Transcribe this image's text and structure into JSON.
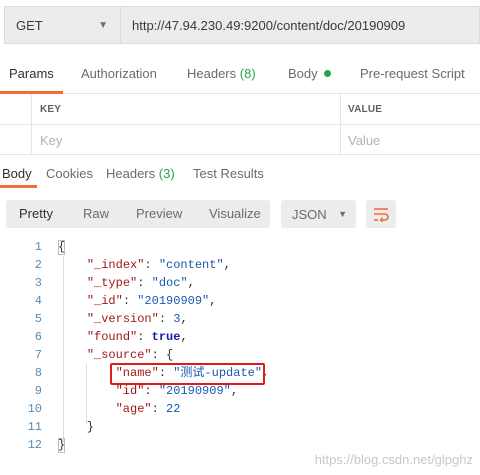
{
  "request": {
    "method": "GET",
    "url": "http://47.94.230.49:9200/content/doc/20190909"
  },
  "request_tabs": [
    {
      "label": "Params",
      "active": true
    },
    {
      "label": "Authorization"
    },
    {
      "label": "Headers",
      "count": "(8)"
    },
    {
      "label": "Body",
      "indicator": "green-dot"
    },
    {
      "label": "Pre-request Script"
    }
  ],
  "params_table": {
    "headers": [
      "KEY",
      "VALUE"
    ],
    "placeholders": [
      "Key",
      "Value"
    ]
  },
  "response_tabs": [
    {
      "label": "Body",
      "active": true
    },
    {
      "label": "Cookies"
    },
    {
      "label": "Headers",
      "count": "(3)"
    },
    {
      "label": "Test Results"
    }
  ],
  "view_modes": [
    "Pretty",
    "Raw",
    "Preview",
    "Visualize"
  ],
  "format": "JSON",
  "toolbar_icons": [
    "chevron-down-icon",
    "wrap-lines-icon"
  ],
  "code_lines": [
    [
      {
        "t": "p",
        "v": "{"
      }
    ],
    [
      {
        "t": "p",
        "v": "    "
      },
      {
        "t": "k",
        "v": "\"_index\""
      },
      {
        "t": "p",
        "v": ": "
      },
      {
        "t": "s",
        "v": "\"content\""
      },
      {
        "t": "p",
        "v": ","
      }
    ],
    [
      {
        "t": "p",
        "v": "    "
      },
      {
        "t": "k",
        "v": "\"_type\""
      },
      {
        "t": "p",
        "v": ": "
      },
      {
        "t": "s",
        "v": "\"doc\""
      },
      {
        "t": "p",
        "v": ","
      }
    ],
    [
      {
        "t": "p",
        "v": "    "
      },
      {
        "t": "k",
        "v": "\"_id\""
      },
      {
        "t": "p",
        "v": ": "
      },
      {
        "t": "s",
        "v": "\"20190909\""
      },
      {
        "t": "p",
        "v": ","
      }
    ],
    [
      {
        "t": "p",
        "v": "    "
      },
      {
        "t": "k",
        "v": "\"_version\""
      },
      {
        "t": "p",
        "v": ": "
      },
      {
        "t": "n",
        "v": "3"
      },
      {
        "t": "p",
        "v": ","
      }
    ],
    [
      {
        "t": "p",
        "v": "    "
      },
      {
        "t": "k",
        "v": "\"found\""
      },
      {
        "t": "p",
        "v": ": "
      },
      {
        "t": "b",
        "v": "true"
      },
      {
        "t": "p",
        "v": ","
      }
    ],
    [
      {
        "t": "p",
        "v": "    "
      },
      {
        "t": "k",
        "v": "\"_source\""
      },
      {
        "t": "p",
        "v": ": {"
      }
    ],
    [
      {
        "t": "p",
        "v": "        "
      },
      {
        "t": "k",
        "v": "\"name\""
      },
      {
        "t": "p",
        "v": ": "
      },
      {
        "t": "s",
        "v": "\"测试-update\""
      },
      {
        "t": "p",
        "v": ","
      }
    ],
    [
      {
        "t": "p",
        "v": "        "
      },
      {
        "t": "k",
        "v": "\"id\""
      },
      {
        "t": "p",
        "v": ": "
      },
      {
        "t": "s",
        "v": "\"20190909\""
      },
      {
        "t": "p",
        "v": ","
      }
    ],
    [
      {
        "t": "p",
        "v": "        "
      },
      {
        "t": "k",
        "v": "\"age\""
      },
      {
        "t": "p",
        "v": ": "
      },
      {
        "t": "n",
        "v": "22"
      }
    ],
    [
      {
        "t": "p",
        "v": "    }"
      }
    ],
    [
      {
        "t": "p",
        "v": "}"
      }
    ]
  ],
  "highlighted_line": 8,
  "watermark": "https://blog.csdn.net/glpghz",
  "colors": {
    "accent": "#f26b3a",
    "count_green": "#29a34a",
    "highlight_border": "#e01b1b",
    "json_key": "#a11818",
    "json_string": "#1a58b0",
    "line_number": "#5a8bb0"
  }
}
